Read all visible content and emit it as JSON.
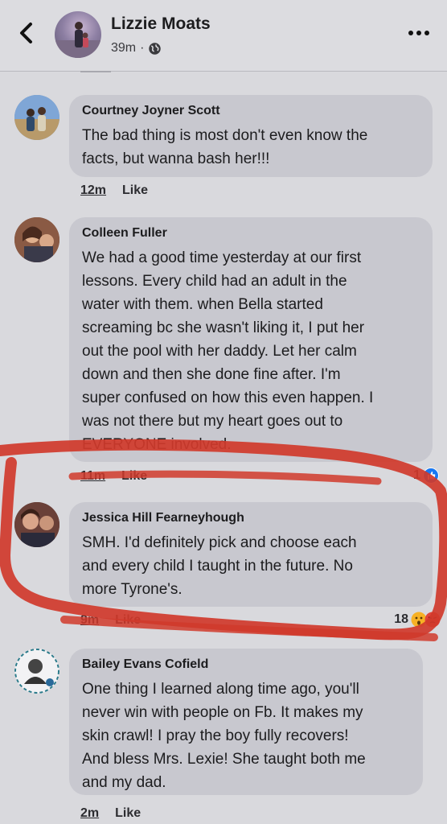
{
  "header": {
    "author": "Lizzie Moats",
    "time": "39m"
  },
  "comments": [
    {
      "author": "Courtney Joyner Scott",
      "text": "The bad thing is most don't even know the\nfacts, but wanna bash her!!!",
      "time": "12m",
      "like": "Like"
    },
    {
      "author": "Colleen Fuller",
      "text": "We had a good time yesterday at our first\nlessons. Every child had an adult in the\nwater with them. when Bella started\nscreaming bc she wasn't liking it, I put her\nout the pool with her daddy. Let her calm\ndown and then she done fine after. I'm\nsuper confused on how this even happen. I\nwas not there but my heart goes out to\nEVERYONE involved.",
      "time": "11m",
      "like": "Like",
      "reaction_count": "1",
      "reaction_icons": [
        "like-reaction-icon"
      ]
    },
    {
      "author": "Jessica Hill Fearneyhough",
      "text": "SMH. I'd definitely pick and choose each\nand every child I taught in the future. No\nmore Tyrone's.",
      "time": "9m",
      "like": "Like",
      "reaction_count": "18",
      "reaction_icons": [
        "wow-reaction-icon",
        "angry-reaction-icon"
      ]
    },
    {
      "author": "Bailey Evans Cofield",
      "text": "One thing I learned along time ago, you'll\nnever win with people on Fb. It makes my\nskin crawl! I pray the boy fully recovers!\nAnd bless Mrs. Lexie! She taught both me\nand my dad.",
      "time": "2m",
      "like": "Like"
    }
  ],
  "colors": {
    "background": "#d9d9dd",
    "bubble": "#c8c8cf",
    "annotation_red": "#d0392b",
    "like_blue": "#1877f2"
  }
}
